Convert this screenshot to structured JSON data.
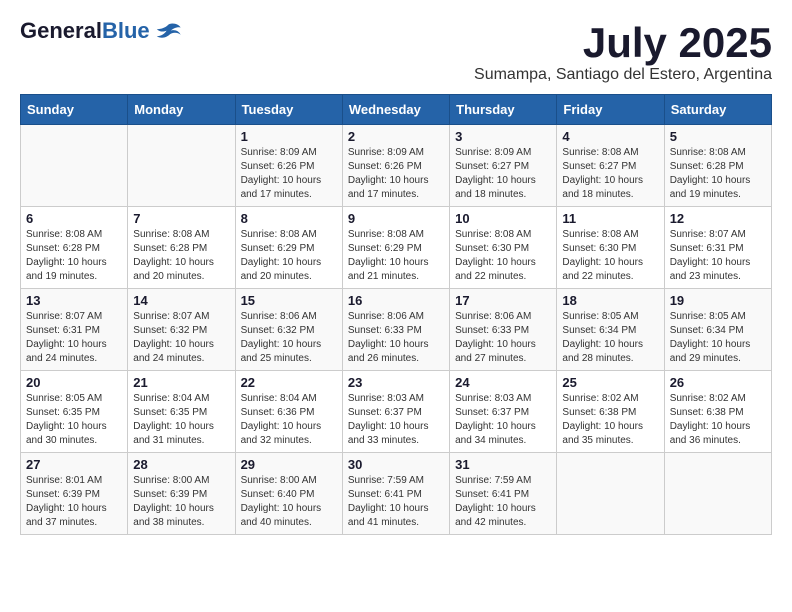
{
  "logo": {
    "general": "General",
    "blue": "Blue"
  },
  "title": "July 2025",
  "subtitle": "Sumampa, Santiago del Estero, Argentina",
  "days_of_week": [
    "Sunday",
    "Monday",
    "Tuesday",
    "Wednesday",
    "Thursday",
    "Friday",
    "Saturday"
  ],
  "weeks": [
    [
      {
        "day": "",
        "info": ""
      },
      {
        "day": "",
        "info": ""
      },
      {
        "day": "1",
        "info": "Sunrise: 8:09 AM\nSunset: 6:26 PM\nDaylight: 10 hours and 17 minutes."
      },
      {
        "day": "2",
        "info": "Sunrise: 8:09 AM\nSunset: 6:26 PM\nDaylight: 10 hours and 17 minutes."
      },
      {
        "day": "3",
        "info": "Sunrise: 8:09 AM\nSunset: 6:27 PM\nDaylight: 10 hours and 18 minutes."
      },
      {
        "day": "4",
        "info": "Sunrise: 8:08 AM\nSunset: 6:27 PM\nDaylight: 10 hours and 18 minutes."
      },
      {
        "day": "5",
        "info": "Sunrise: 8:08 AM\nSunset: 6:28 PM\nDaylight: 10 hours and 19 minutes."
      }
    ],
    [
      {
        "day": "6",
        "info": "Sunrise: 8:08 AM\nSunset: 6:28 PM\nDaylight: 10 hours and 19 minutes."
      },
      {
        "day": "7",
        "info": "Sunrise: 8:08 AM\nSunset: 6:28 PM\nDaylight: 10 hours and 20 minutes."
      },
      {
        "day": "8",
        "info": "Sunrise: 8:08 AM\nSunset: 6:29 PM\nDaylight: 10 hours and 20 minutes."
      },
      {
        "day": "9",
        "info": "Sunrise: 8:08 AM\nSunset: 6:29 PM\nDaylight: 10 hours and 21 minutes."
      },
      {
        "day": "10",
        "info": "Sunrise: 8:08 AM\nSunset: 6:30 PM\nDaylight: 10 hours and 22 minutes."
      },
      {
        "day": "11",
        "info": "Sunrise: 8:08 AM\nSunset: 6:30 PM\nDaylight: 10 hours and 22 minutes."
      },
      {
        "day": "12",
        "info": "Sunrise: 8:07 AM\nSunset: 6:31 PM\nDaylight: 10 hours and 23 minutes."
      }
    ],
    [
      {
        "day": "13",
        "info": "Sunrise: 8:07 AM\nSunset: 6:31 PM\nDaylight: 10 hours and 24 minutes."
      },
      {
        "day": "14",
        "info": "Sunrise: 8:07 AM\nSunset: 6:32 PM\nDaylight: 10 hours and 24 minutes."
      },
      {
        "day": "15",
        "info": "Sunrise: 8:06 AM\nSunset: 6:32 PM\nDaylight: 10 hours and 25 minutes."
      },
      {
        "day": "16",
        "info": "Sunrise: 8:06 AM\nSunset: 6:33 PM\nDaylight: 10 hours and 26 minutes."
      },
      {
        "day": "17",
        "info": "Sunrise: 8:06 AM\nSunset: 6:33 PM\nDaylight: 10 hours and 27 minutes."
      },
      {
        "day": "18",
        "info": "Sunrise: 8:05 AM\nSunset: 6:34 PM\nDaylight: 10 hours and 28 minutes."
      },
      {
        "day": "19",
        "info": "Sunrise: 8:05 AM\nSunset: 6:34 PM\nDaylight: 10 hours and 29 minutes."
      }
    ],
    [
      {
        "day": "20",
        "info": "Sunrise: 8:05 AM\nSunset: 6:35 PM\nDaylight: 10 hours and 30 minutes."
      },
      {
        "day": "21",
        "info": "Sunrise: 8:04 AM\nSunset: 6:35 PM\nDaylight: 10 hours and 31 minutes."
      },
      {
        "day": "22",
        "info": "Sunrise: 8:04 AM\nSunset: 6:36 PM\nDaylight: 10 hours and 32 minutes."
      },
      {
        "day": "23",
        "info": "Sunrise: 8:03 AM\nSunset: 6:37 PM\nDaylight: 10 hours and 33 minutes."
      },
      {
        "day": "24",
        "info": "Sunrise: 8:03 AM\nSunset: 6:37 PM\nDaylight: 10 hours and 34 minutes."
      },
      {
        "day": "25",
        "info": "Sunrise: 8:02 AM\nSunset: 6:38 PM\nDaylight: 10 hours and 35 minutes."
      },
      {
        "day": "26",
        "info": "Sunrise: 8:02 AM\nSunset: 6:38 PM\nDaylight: 10 hours and 36 minutes."
      }
    ],
    [
      {
        "day": "27",
        "info": "Sunrise: 8:01 AM\nSunset: 6:39 PM\nDaylight: 10 hours and 37 minutes."
      },
      {
        "day": "28",
        "info": "Sunrise: 8:00 AM\nSunset: 6:39 PM\nDaylight: 10 hours and 38 minutes."
      },
      {
        "day": "29",
        "info": "Sunrise: 8:00 AM\nSunset: 6:40 PM\nDaylight: 10 hours and 40 minutes."
      },
      {
        "day": "30",
        "info": "Sunrise: 7:59 AM\nSunset: 6:41 PM\nDaylight: 10 hours and 41 minutes."
      },
      {
        "day": "31",
        "info": "Sunrise: 7:59 AM\nSunset: 6:41 PM\nDaylight: 10 hours and 42 minutes."
      },
      {
        "day": "",
        "info": ""
      },
      {
        "day": "",
        "info": ""
      }
    ]
  ]
}
